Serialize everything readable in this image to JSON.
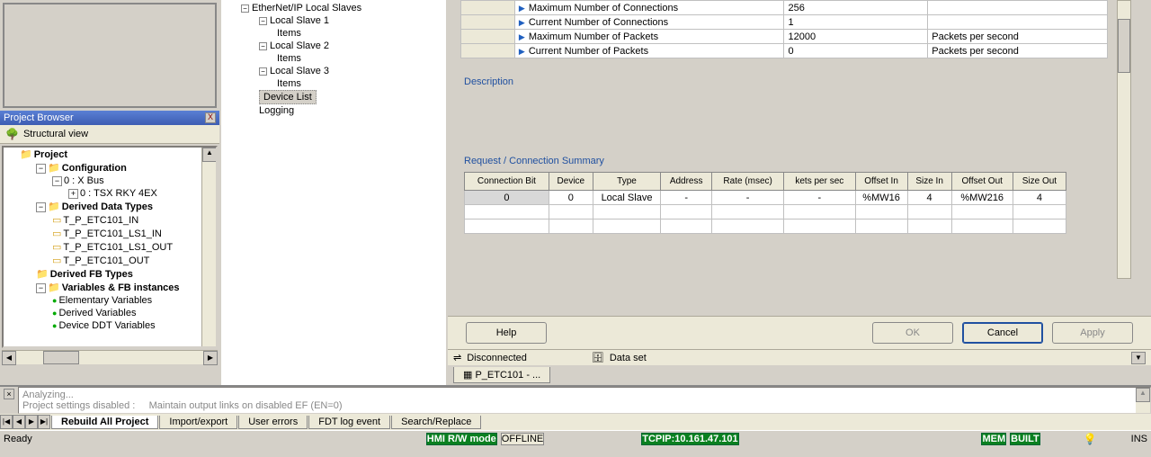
{
  "project_browser": {
    "title": "Project Browser",
    "toolbar_label": "Structural view",
    "tree": {
      "project": "Project",
      "config": "Configuration",
      "xbus": "0 : X Bus",
      "tsx": "0 : TSX RKY 4EX",
      "ddt": "Derived Data Types",
      "ddt_items": [
        "T_P_ETC101_IN",
        "T_P_ETC101_LS1_IN",
        "T_P_ETC101_LS1_OUT",
        "T_P_ETC101_OUT"
      ],
      "dfb": "Derived FB Types",
      "vars": "Variables & FB instances",
      "var_items": [
        "Elementary Variables",
        "Derived Variables",
        "Device DDT Variables"
      ]
    }
  },
  "center_tree": {
    "root": "EtherNet/IP Local Slaves",
    "slaves": [
      "Local Slave 1",
      "Local Slave 2",
      "Local Slave 3"
    ],
    "items_label": "Items",
    "device_list": "Device List",
    "logging": "Logging"
  },
  "props": [
    {
      "label": "Maximum Number of Connections",
      "value": "256",
      "unit": ""
    },
    {
      "label": "Current Number of Connections",
      "value": "1",
      "unit": ""
    },
    {
      "label": "Maximum Number of Packets",
      "value": "12000",
      "unit": "Packets per second"
    },
    {
      "label": "Current Number of Packets",
      "value": "0",
      "unit": "Packets per second"
    }
  ],
  "sections": {
    "description": "Description",
    "summary": "Request / Connection Summary"
  },
  "summary": {
    "headers": [
      "Connection Bit",
      "Device",
      "Type",
      "Address",
      "Rate (msec)",
      "kets per sec",
      "Offset In",
      "Size In",
      "Offset Out",
      "Size Out"
    ],
    "row": [
      "0",
      "0",
      "Local Slave",
      "-",
      "-",
      "-",
      "%MW16",
      "4",
      "%MW216",
      "4"
    ]
  },
  "buttons": {
    "help": "Help",
    "ok": "OK",
    "cancel": "Cancel",
    "apply": "Apply"
  },
  "conn_status": {
    "disconnected": "Disconnected",
    "dataset": "Data set"
  },
  "doc_tab": "P_ETC101 - ...",
  "output": {
    "line1": "Analyzing...",
    "line2_a": "Project settings disabled :",
    "line2_b": "Maintain output links on disabled EF (EN=0)",
    "tabs": [
      "Rebuild All Project",
      "Import/export",
      "User errors",
      "FDT log event",
      "Search/Replace"
    ]
  },
  "statusbar": {
    "ready": "Ready",
    "hmi": "HMI R/W mode",
    "offline": "OFFLINE",
    "tcpip": "TCPIP:10.161.47.101",
    "mem": "MEM",
    "built": "BUILT",
    "ins": "INS"
  }
}
